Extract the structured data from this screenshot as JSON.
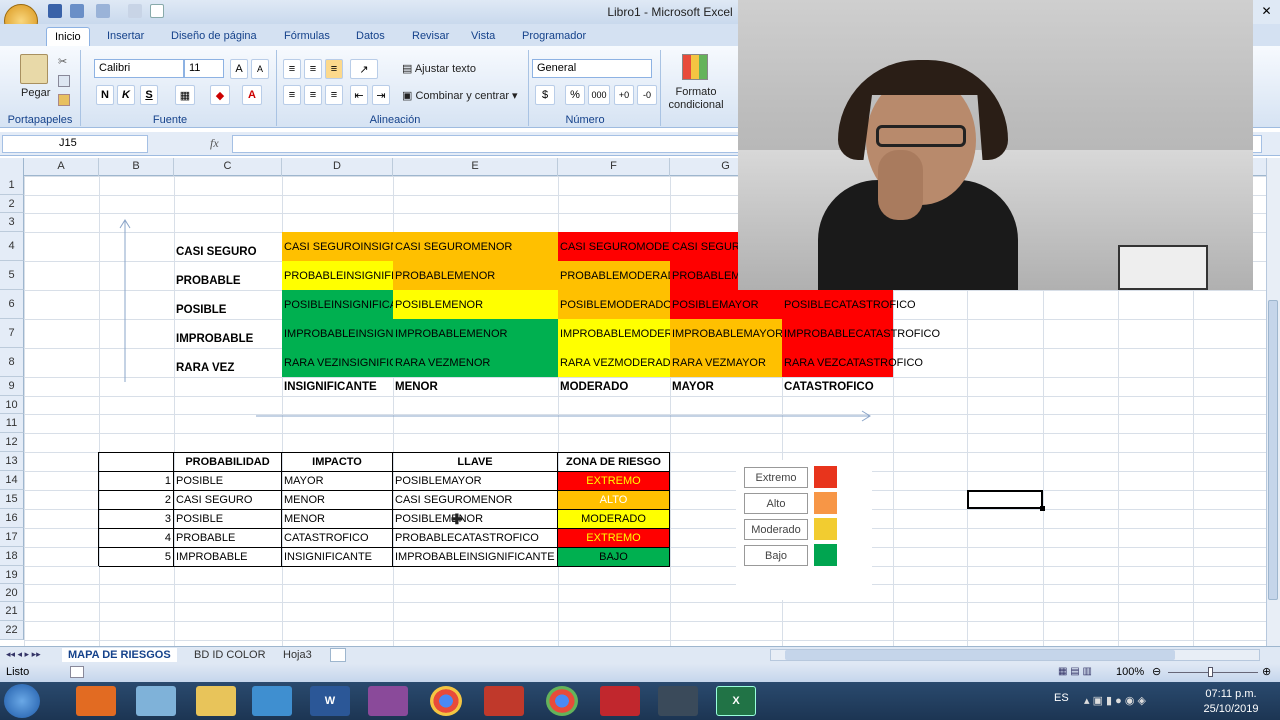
{
  "window": {
    "title": "Libro1 - Microsoft Excel"
  },
  "ribbon_tabs": [
    "Inicio",
    "Insertar",
    "Diseño de página",
    "Fórmulas",
    "Datos",
    "Revisar",
    "Vista",
    "Programador"
  ],
  "ribbon": {
    "paste": "Pegar",
    "font_name": "Calibri",
    "font_size": "11",
    "bold": "N",
    "italic": "K",
    "underline": "S",
    "wrap_text": "Ajustar texto",
    "merge_center": "Combinar y centrar",
    "number_format": "General",
    "currency": "$",
    "percent": "%",
    "thousands": "000",
    "cond_format_1": "Formato",
    "cond_format_2": "condicional",
    "groups": {
      "clipboard": "Portapapeles",
      "font": "Fuente",
      "alignment": "Alineación",
      "number": "Número"
    }
  },
  "formula_bar": {
    "name_box": "J15",
    "fx": "fx"
  },
  "columns": [
    "A",
    "B",
    "C",
    "D",
    "E",
    "F",
    "G"
  ],
  "rows": [
    "1",
    "2",
    "3",
    "4",
    "5",
    "6",
    "7",
    "8",
    "9",
    "10",
    "11",
    "12",
    "13",
    "14",
    "15",
    "16",
    "17",
    "18",
    "19",
    "20",
    "21",
    "22"
  ],
  "matrix": {
    "row_labels": [
      "CASI SEGURO",
      "PROBABLE",
      "POSIBLE",
      "IMPROBABLE",
      "RARA VEZ"
    ],
    "col_labels": [
      "INSIGNIFICANTE",
      "MENOR",
      "MODERADO",
      "MAYOR",
      "CATASTROFICO"
    ],
    "cells": [
      [
        "CASI SEGUROINSIGNIFICANTE",
        "CASI SEGUROMENOR",
        "CASI SEGUROMODERADO",
        "CASI SEGUROMAYOR",
        ""
      ],
      [
        "PROBABLEINSIGNIFICANTE",
        "PROBABLEMENOR",
        "PROBABLEMODERADO",
        "PROBABLEMAYOR",
        ""
      ],
      [
        "POSIBLEINSIGNIFICANTE",
        "POSIBLEMENOR",
        "POSIBLEMODERADO",
        "POSIBLEMAYOR",
        "POSIBLECATASTROFICO"
      ],
      [
        "IMPROBABLEINSIGNIFICANTE",
        "IMPROBABLEMENOR",
        "IMPROBABLEMODERADO",
        "IMPROBABLEMAYOR",
        "IMPROBABLECATASTROFICO"
      ],
      [
        "RARA VEZINSIGNIFICANTE",
        "RARA VEZMENOR",
        "RARA VEZMODERADO",
        "RARA VEZMAYOR",
        "RARA VEZCATASTROFICO"
      ]
    ]
  },
  "table": {
    "headers": [
      "PROBABILIDAD",
      "IMPACTO",
      "LLAVE",
      "ZONA DE RIESGO"
    ],
    "rows": [
      {
        "n": "1",
        "prob": "POSIBLE",
        "imp": "MAYOR",
        "key": "POSIBLEMAYOR",
        "zone": "EXTREMO"
      },
      {
        "n": "2",
        "prob": "CASI SEGURO",
        "imp": "MENOR",
        "key": "CASI SEGUROMENOR",
        "zone": "ALTO"
      },
      {
        "n": "3",
        "prob": "POSIBLE",
        "imp": "MENOR",
        "key": "POSIBLEMENOR",
        "zone": "MODERADO"
      },
      {
        "n": "4",
        "prob": "PROBABLE",
        "imp": "CATASTROFICO",
        "key": "PROBABLECATASTROFICO",
        "zone": "EXTREMO"
      },
      {
        "n": "5",
        "prob": "IMPROBABLE",
        "imp": "INSIGNIFICANTE",
        "key": "IMPROBABLEINSIGNIFICANTE",
        "zone": "BAJO"
      }
    ]
  },
  "legend": [
    {
      "label": "Extremo",
      "color": "#e8341c"
    },
    {
      "label": "Alto",
      "color": "#f79646"
    },
    {
      "label": "Moderado",
      "color": "#f2cc30"
    },
    {
      "label": "Bajo",
      "color": "#00a550"
    }
  ],
  "sheet_tabs": [
    "MAPA DE RIESGOS",
    "BD ID COLOR",
    "Hoja3"
  ],
  "status": {
    "ready": "Listo",
    "zoom": "100%"
  },
  "taskbar": {
    "lang": "ES",
    "time": "07:11 p.m.",
    "date": "25/10/2019"
  }
}
